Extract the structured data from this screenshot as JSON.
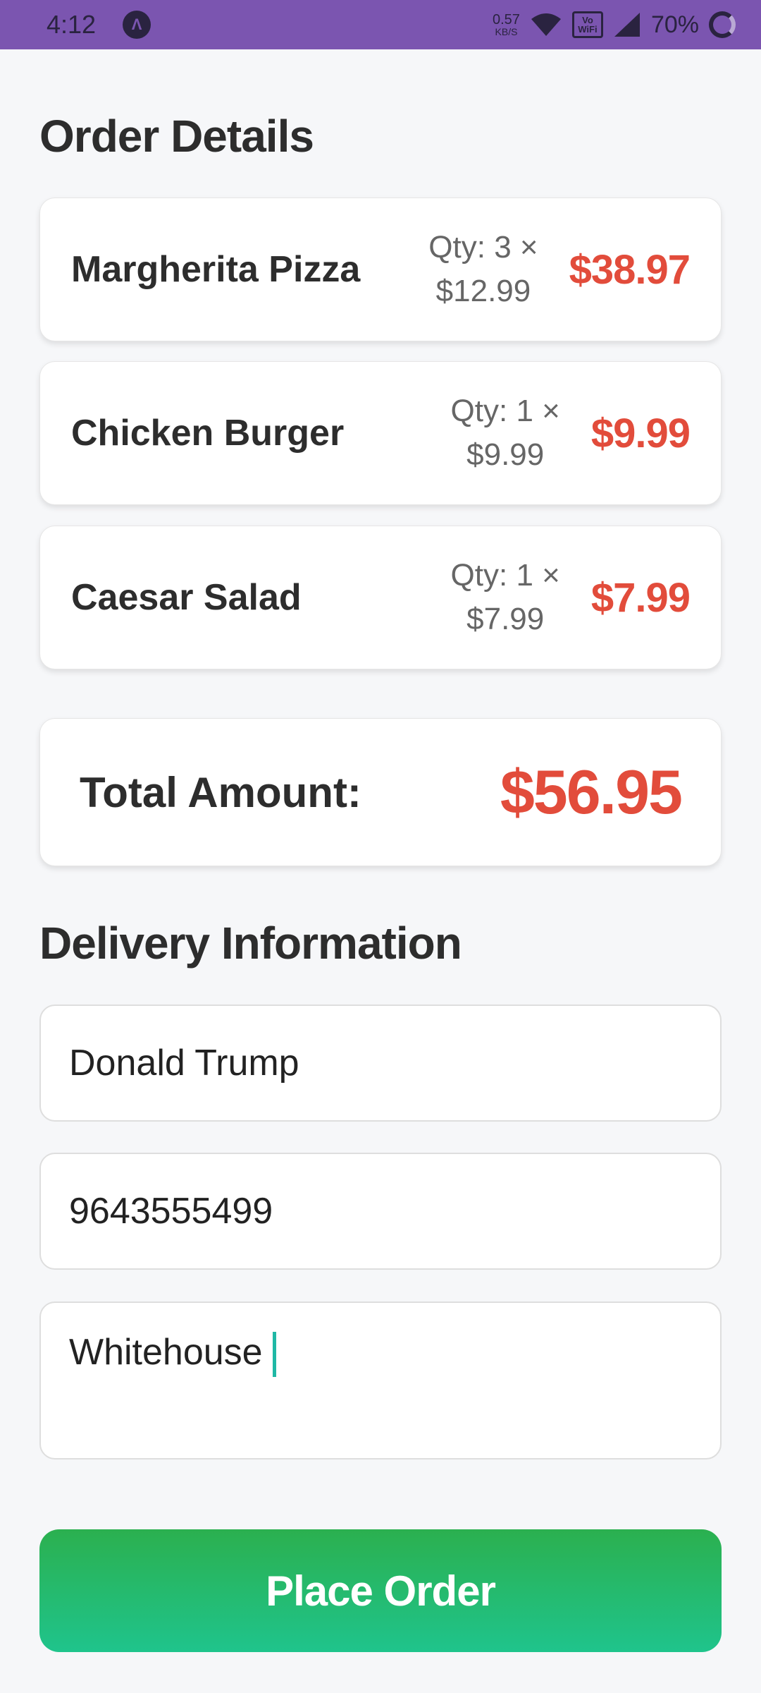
{
  "status_bar": {
    "time": "4:12",
    "app_icon_glyph": "Λ",
    "net_speed_value": "0.57",
    "net_speed_unit": "KB/S",
    "vowifi_top": "Vo",
    "vowifi_bottom": "WiFi",
    "battery": "70%"
  },
  "order": {
    "title": "Order Details",
    "items": [
      {
        "name": "Margherita Pizza",
        "qty_line1": "Qty: 3 ×",
        "qty_line2": "$12.99",
        "total": "$38.97"
      },
      {
        "name": "Chicken Burger",
        "qty_line1": "Qty: 1 ×",
        "qty_line2": "$9.99",
        "total": "$9.99"
      },
      {
        "name": "Caesar Salad",
        "qty_line1": "Qty: 1 ×",
        "qty_line2": "$7.99",
        "total": "$7.99"
      }
    ],
    "total_label": "Total Amount:",
    "total_value": "$56.95"
  },
  "delivery": {
    "title": "Delivery Information",
    "name_value": "Donald Trump",
    "phone_value": "9643555499",
    "address_value": "Whitehouse"
  },
  "actions": {
    "place_order_label": "Place Order"
  },
  "colors": {
    "status_bar": "#7b55b0",
    "price_red": "#e24c3b",
    "button_green": "#2bb04f",
    "caret_teal": "#1fb8a5"
  }
}
